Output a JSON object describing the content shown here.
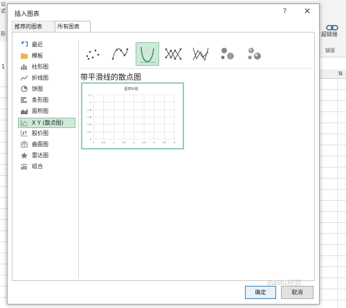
{
  "background": {
    "ribbon_left_top": "公式",
    "ribbon_left_bottom": "形",
    "hyperlink_label": "超链接",
    "links_group_label": "链接",
    "cell_ref": "1",
    "column_letter": "N"
  },
  "dialog": {
    "title": "插入图表",
    "help": "?",
    "close": "✕",
    "tabs": [
      {
        "label": "推荐的图表",
        "active": false
      },
      {
        "label": "所有图表",
        "active": true
      }
    ],
    "categories": [
      {
        "label": "最近",
        "icon": "recent-icon"
      },
      {
        "label": "模板",
        "icon": "template-folder-icon"
      },
      {
        "label": "柱形图",
        "icon": "column-chart-icon"
      },
      {
        "label": "折线图",
        "icon": "line-chart-icon"
      },
      {
        "label": "饼图",
        "icon": "pie-chart-icon"
      },
      {
        "label": "条形图",
        "icon": "bar-chart-icon"
      },
      {
        "label": "面积图",
        "icon": "area-chart-icon"
      },
      {
        "label": "X Y (散点图)",
        "icon": "scatter-chart-icon",
        "selected": true
      },
      {
        "label": "股价图",
        "icon": "stock-chart-icon"
      },
      {
        "label": "曲面图",
        "icon": "surface-chart-icon"
      },
      {
        "label": "雷达图",
        "icon": "radar-chart-icon"
      },
      {
        "label": "组合",
        "icon": "combo-chart-icon"
      }
    ],
    "subtypes": [
      {
        "icon": "scatter-icon"
      },
      {
        "icon": "scatter-smooth-markers-icon"
      },
      {
        "icon": "scatter-smooth-lines-icon",
        "selected": true
      },
      {
        "icon": "scatter-straight-markers-icon"
      },
      {
        "icon": "scatter-straight-lines-icon"
      },
      {
        "icon": "bubble-icon"
      },
      {
        "icon": "bubble-3d-icon"
      }
    ],
    "selected_subtype_title": "带平滑线的散点图",
    "preview": {
      "title": "图表标题",
      "y_ticks": [
        "1.2",
        "1",
        "0.8",
        "0.6",
        "0.4",
        "0.2",
        "0"
      ],
      "x_ticks": [
        "0",
        "0.5",
        "1",
        "1.5",
        "2",
        "2.5",
        "3",
        "3.5",
        "4"
      ]
    },
    "ok_label": "确定",
    "cancel_label": "取消"
  },
  "watermark": "Baidu经验",
  "colors": {
    "selection_fill": "#cfe9d9",
    "selection_border": "#8bc7a2",
    "icon_green": "#3a9a5b",
    "icon_gray": "#7a7a7a",
    "dialog_border": "#9aa6b5"
  }
}
